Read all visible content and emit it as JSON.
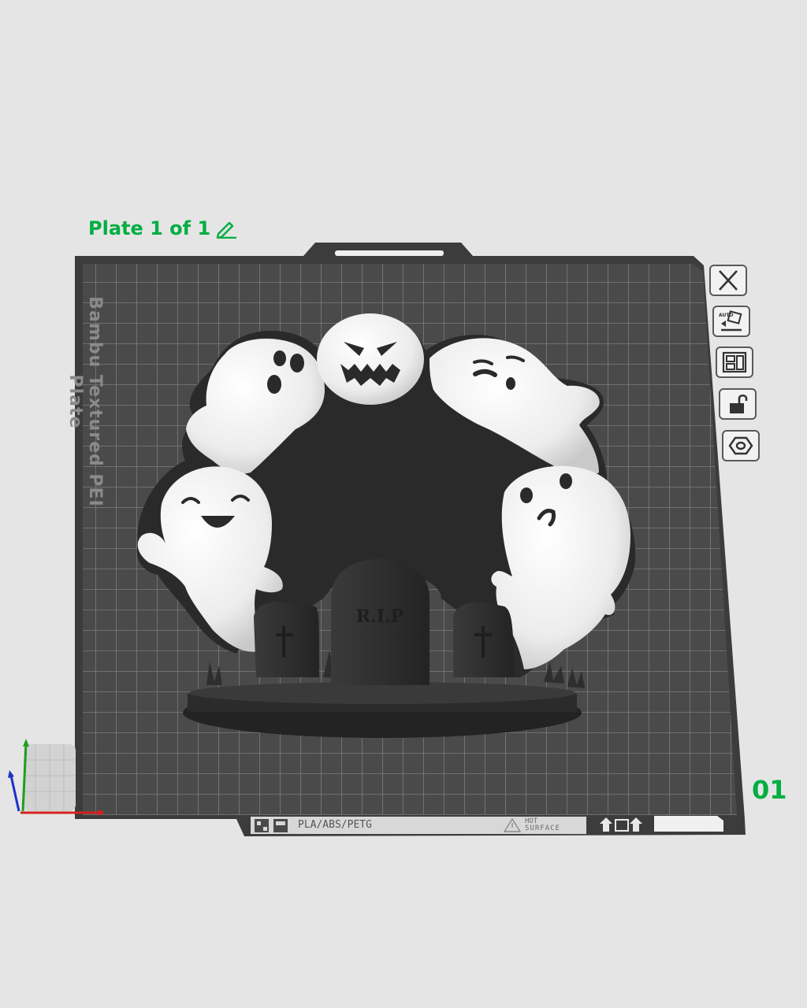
{
  "plate": {
    "title": "Plate 1 of 1",
    "number": "01",
    "bed_label": "Bambu Textured PEI Plate",
    "material_label": "PLA/ABS/PETG",
    "hot_surface_label_line1": "HOT",
    "hot_surface_label_line2": "SURFACE",
    "auto_label": "AUTO"
  },
  "model": {
    "tombstone_text": "R.I.P"
  },
  "toolbar": {
    "buttons": [
      {
        "name": "delete-plate-button",
        "icon": "close-icon"
      },
      {
        "name": "auto-orient-button",
        "icon": "auto-orient-icon"
      },
      {
        "name": "arrange-button",
        "icon": "arrange-icon"
      },
      {
        "name": "lock-plate-button",
        "icon": "unlock-icon"
      },
      {
        "name": "plate-settings-button",
        "icon": "settings-icon"
      }
    ]
  },
  "colors": {
    "accent": "#00ae42",
    "background": "#e5e5e5",
    "bed": "#4a4a4a",
    "bed_grid": "#7a7a7a",
    "model_white": "#f5f5f5",
    "model_black": "#2a2a2a"
  }
}
